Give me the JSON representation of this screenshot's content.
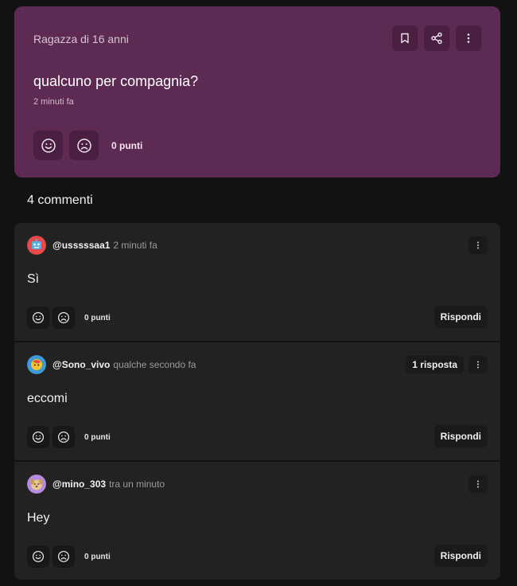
{
  "post": {
    "author": "Ragazza di 16 anni",
    "title": "qualcuno per compagnia?",
    "time": "2 minuti fa",
    "points": "0 punti",
    "icons": [
      "bookmark-icon",
      "share-icon",
      "more-vertical-icon",
      "smile-icon",
      "frown-icon"
    ]
  },
  "comments_header": "4 commenti",
  "comments": [
    {
      "username": "@usssssaa1",
      "time": "2 minuti fa",
      "text": "Sì",
      "points": "0 punti",
      "reply_label": "Rispondi",
      "reply_count": ""
    },
    {
      "username": "@Sono_vivo",
      "time": "qualche secondo fa",
      "text": "eccomi",
      "points": "0 punti",
      "reply_label": "Rispondi",
      "reply_count": "1 risposta"
    },
    {
      "username": "@mino_303",
      "time": "tra un minuto",
      "text": "Hey",
      "points": "0 punti",
      "reply_label": "Rispondi",
      "reply_count": ""
    }
  ],
  "colors": {
    "page_bg": "#121212",
    "post_bg": "#5c2a52",
    "post_button_bg": "#4a1f41",
    "comment_bg": "#222222"
  }
}
